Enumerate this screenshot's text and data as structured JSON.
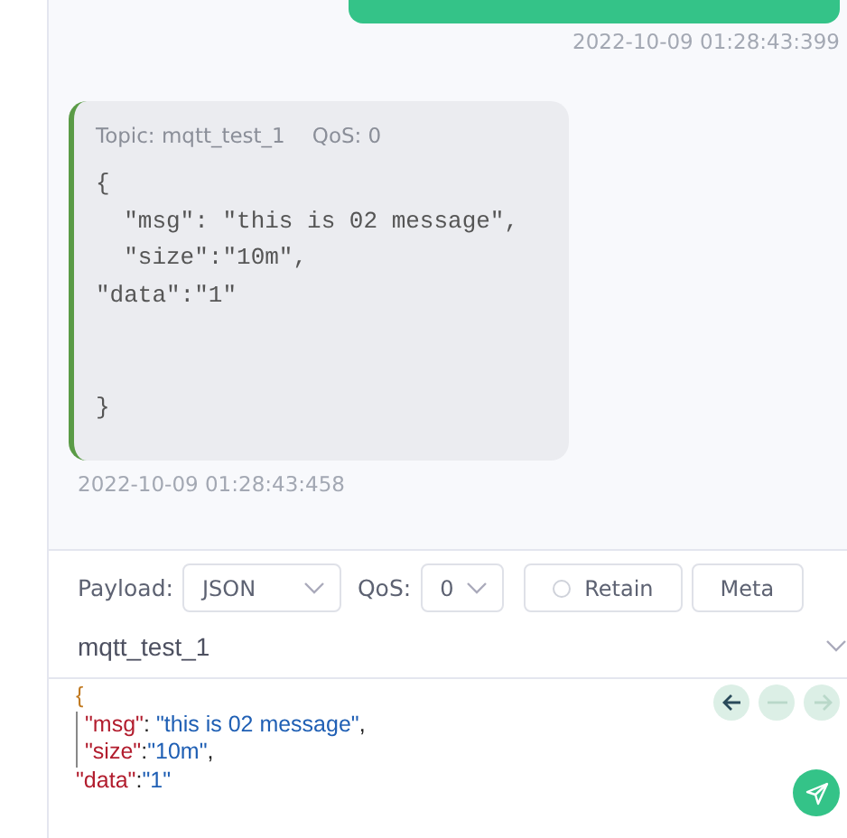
{
  "messages": [
    {
      "kind": "sent",
      "time": "2022-10-09 01:28:43:399"
    },
    {
      "kind": "received",
      "topic": "Topic: mqtt_test_1",
      "qos": "QoS: 0",
      "payload": "{\n  \"msg\": \"this is 02 message\",\n  \"size\":\"10m\",\n\"data\":\"1\"\n\n\n}",
      "time": "2022-10-09 01:28:43:458"
    }
  ],
  "composer": {
    "payload_label": "Payload:",
    "payload_format": "JSON",
    "qos_label": "QoS:",
    "qos": "0",
    "retain": {
      "label": "Retain",
      "checked": false
    },
    "meta_button": "Meta",
    "topic": "mqtt_test_1",
    "editor_lines": [
      {
        "indent": false,
        "tokens": [
          {
            "text": "{",
            "kind": "brace"
          }
        ]
      },
      {
        "indent": true,
        "tokens": [
          {
            "text": "\"msg\"",
            "kind": "key"
          },
          {
            "text": ": ",
            "kind": "punct"
          },
          {
            "text": "\"this is 02 message\"",
            "kind": "string"
          },
          {
            "text": ",",
            "kind": "punct"
          }
        ]
      },
      {
        "indent": true,
        "tokens": [
          {
            "text": "\"size\"",
            "kind": "key"
          },
          {
            "text": ":",
            "kind": "punct"
          },
          {
            "text": "\"10m\"",
            "kind": "string"
          },
          {
            "text": ",",
            "kind": "punct"
          }
        ]
      },
      {
        "indent": false,
        "tokens": [
          {
            "text": "\"data\"",
            "kind": "key"
          },
          {
            "text": ":",
            "kind": "punct"
          },
          {
            "text": "\"1\"",
            "kind": "string"
          }
        ]
      }
    ],
    "history_buttons": [
      {
        "kind": "back",
        "disabled": false
      },
      {
        "kind": "clear",
        "disabled": true
      },
      {
        "kind": "forward",
        "disabled": true
      }
    ]
  }
}
